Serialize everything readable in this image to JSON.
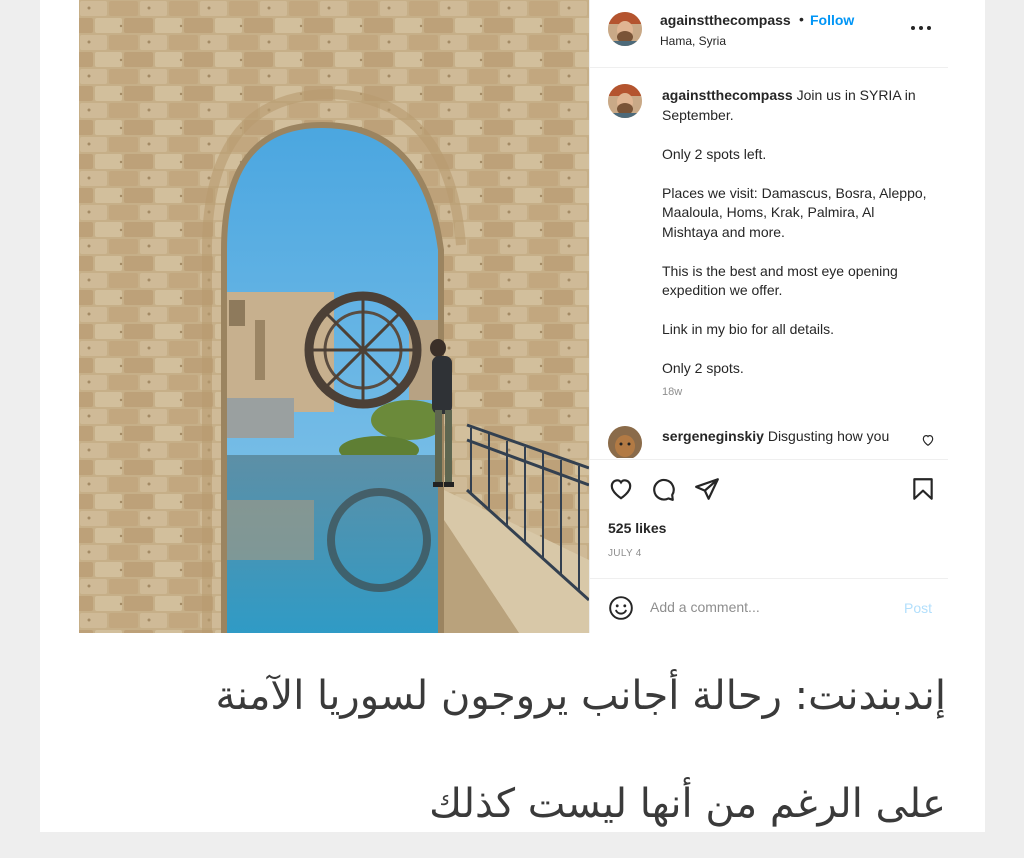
{
  "post": {
    "username": "againstthecompass",
    "separator": "•",
    "follow_label": "Follow",
    "location": "Hama, Syria",
    "more_icon": "more-horizontal-icon",
    "caption": {
      "username": "againstthecompass",
      "first_line": "Join us in SYRIA in September.",
      "paragraphs": [
        "Only 2 spots left.",
        "Places we visit: Damascus, Bosra, Aleppo, Maaloula, Homs, Krak, Palmira, Al Mishtaya and more.",
        "This is the best and most eye opening expedition we offer.",
        "Link in my bio for all details.",
        "Only 2 spots."
      ],
      "time": "18w"
    },
    "comment": {
      "username": "sergeneginskiy",
      "text": "Disgusting how you"
    },
    "likes": "525 likes",
    "date": "JULY 4",
    "comment_placeholder": "Add a comment...",
    "post_label": "Post",
    "colors": {
      "link_blue": "#0095f6",
      "post_disabled": "#b2dffc",
      "text": "#262626",
      "muted": "#8e8e8e"
    }
  },
  "headline": {
    "line1": "إندبندنت: رحالة أجانب يروجون لسوريا الآمنة",
    "line2": "على الرغم من أنها ليست كذلك"
  }
}
